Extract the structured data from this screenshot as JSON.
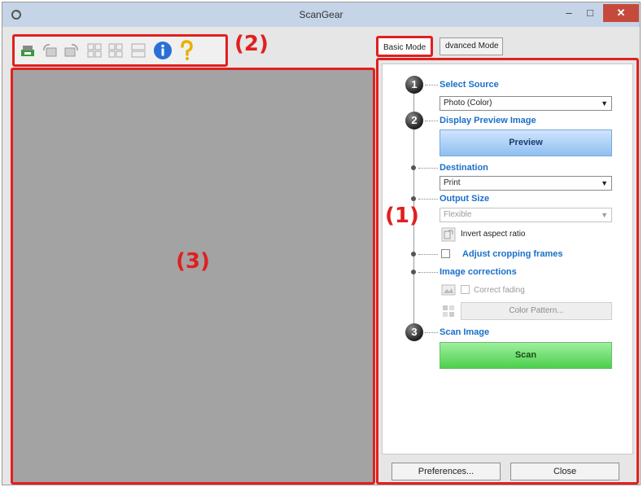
{
  "window": {
    "title": "ScanGear"
  },
  "callouts": {
    "settings": "(1)",
    "toolbar": "(2)",
    "preview": "(3)"
  },
  "toolbar": {
    "icons": [
      "scan-settings-icon",
      "rotate-left-icon",
      "rotate-right-icon",
      "thumbnail-grid-icon",
      "whole-image-icon",
      "multi-crop-icon",
      "info-icon",
      "help-icon"
    ]
  },
  "tabs": [
    {
      "label": "Basic Mode"
    },
    {
      "label": "dvanced Mode"
    }
  ],
  "steps": [
    "1",
    "2",
    "3"
  ],
  "settings": {
    "select_source": {
      "label": "Select Source",
      "value": "Photo (Color)"
    },
    "display_preview": {
      "label": "Display Preview Image",
      "button": "Preview"
    },
    "destination": {
      "label": "Destination",
      "value": "Print"
    },
    "output_size": {
      "label": "Output Size",
      "value": "Flexible",
      "invert_label": "Invert aspect ratio"
    },
    "adjust_cropping": {
      "label": "Adjust cropping frames"
    },
    "image_corrections": {
      "label": "Image corrections",
      "correct_fading": "Correct fading",
      "color_pattern": "Color Pattern..."
    },
    "scan_image": {
      "label": "Scan Image",
      "button": "Scan"
    }
  },
  "footer": {
    "preferences": "Preferences...",
    "close": "Close"
  },
  "colors": {
    "accent_red": "#e02020",
    "section_blue": "#1a6fc9",
    "preview_bg": "#a3a3a3",
    "scan_green": "#4ccf4c",
    "preview_blue": "#8fbff0"
  }
}
